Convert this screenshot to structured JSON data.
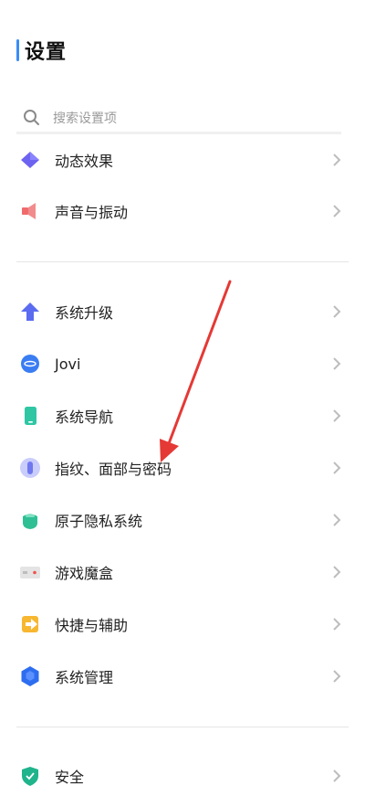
{
  "header": {
    "title": "设置",
    "accent_color": "#3a8df5"
  },
  "search": {
    "placeholder": "搜索设置项"
  },
  "groups": [
    {
      "items": [
        {
          "label": "动态效果",
          "icon": "diamond-icon"
        },
        {
          "label": "声音与振动",
          "icon": "speaker-icon"
        }
      ]
    },
    {
      "items": [
        {
          "label": "系统升级",
          "icon": "arrow-up-icon"
        },
        {
          "label": "Jovi",
          "icon": "jovi-icon"
        },
        {
          "label": "系统导航",
          "icon": "phone-icon"
        },
        {
          "label": "指纹、面部与密码",
          "icon": "fingerprint-icon"
        },
        {
          "label": "原子隐私系统",
          "icon": "privacy-icon"
        },
        {
          "label": "游戏魔盒",
          "icon": "game-box-icon"
        },
        {
          "label": "快捷与辅助",
          "icon": "shortcut-arrow-icon"
        },
        {
          "label": "系统管理",
          "icon": "hexagon-icon"
        }
      ]
    },
    {
      "items": [
        {
          "label": "安全",
          "icon": "shield-icon"
        }
      ]
    }
  ],
  "annotation": {
    "color": "#e53935",
    "icon": "red-arrow-annotation"
  }
}
